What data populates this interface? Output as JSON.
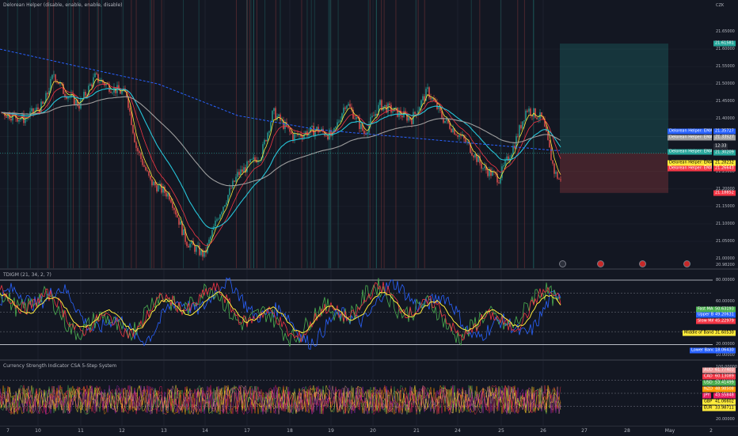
{
  "main": {
    "title": "Delorean Helper (disable, enable, enable, disable)",
    "currency": "CZK",
    "price_ticks": [
      "21.65000",
      "21.60000",
      "21.55000",
      "21.50000",
      "21.45000",
      "21.40000",
      "21.35000",
      "21.30000",
      "21.25000",
      "21.20000",
      "21.15000",
      "21.10000",
      "21.05000",
      "21.00000",
      "20.98200"
    ],
    "position_top": "21.61581",
    "stop_price": "21.18852",
    "last_price": "21.30209",
    "right_badges": [
      {
        "value": "21.35727",
        "color": "#2962ff"
      },
      {
        "value": "21.33527",
        "color": "#9e9e9e"
      },
      {
        "value": "21.30209",
        "color": "#26a69a"
      },
      {
        "value": "21.28232",
        "color": "#ffeb3b"
      },
      {
        "value": "21.26643",
        "color": "#f23645"
      }
    ],
    "series_labels": [
      {
        "text": "Delorean Helper: EMA 800",
        "color": "#2962ff"
      },
      {
        "text": "Delorean Helper: EMA 200",
        "color": "#9e9e9e"
      },
      {
        "text": "Delorean Helper: EMA 50",
        "color": "#26a69a"
      },
      {
        "text": "Delorean Helper: EMA 5",
        "color": "#ffeb3b"
      },
      {
        "text": "Delorean Helper: EMA 13",
        "color": "#f23645"
      }
    ],
    "price_timer": "12:33",
    "event_icons": [
      "earnings-icon",
      "flag-icon",
      "flag-icon",
      "flag-icon"
    ]
  },
  "tdi": {
    "title": "TDIGM (21, 34, 2, 7)",
    "ticks": [
      "80.00000",
      "60.00000",
      "40.00000",
      "20.00000",
      "10.00000"
    ],
    "values": [
      {
        "label": "Fast MA",
        "value": "50.63193",
        "color": "#4caf50"
      },
      {
        "label": "Upper Band",
        "value": "49.20631",
        "color": "#2962ff"
      },
      {
        "label": "Slow MA",
        "value": "45.22979",
        "color": "#f23645"
      },
      {
        "label": "Middle of Bands",
        "value": "31.60530",
        "color": "#ffeb3b"
      },
      {
        "label": "Lower Band",
        "value": "18.06430",
        "color": "#2962ff"
      }
    ]
  },
  "csi": {
    "title": "Currency Strength Indicator CSA 5-Step System",
    "ticks": [
      "100.00000",
      "80.00000",
      "60.00000",
      "40.00000",
      "20.00000"
    ],
    "values": [
      {
        "label": "AUD",
        "value": "61.77403",
        "color": "#ef9a9a"
      },
      {
        "label": "CAD",
        "value": "60.13089",
        "color": "#f23645"
      },
      {
        "label": "USD",
        "value": "53.41499",
        "color": "#4caf50"
      },
      {
        "label": "NZD",
        "value": "48.98508",
        "color": "#ff9800"
      },
      {
        "label": "JPY",
        "value": "43.55848",
        "color": "#e91e63"
      },
      {
        "label": "GBP",
        "value": "41.06602",
        "color": "#ffeb3b"
      },
      {
        "label": "EUR",
        "value": "33.98711",
        "color": "#ffeb3b"
      }
    ]
  },
  "x_axis": [
    "7",
    "10",
    "11",
    "12",
    "13",
    "14",
    "17",
    "18",
    "19",
    "20",
    "21",
    "24",
    "25",
    "26",
    "27",
    "28",
    "May",
    "2"
  ],
  "colors": {
    "bg": "#131722",
    "grid": "#1e222d",
    "up": "#26a69a",
    "down": "#ef5350"
  }
}
